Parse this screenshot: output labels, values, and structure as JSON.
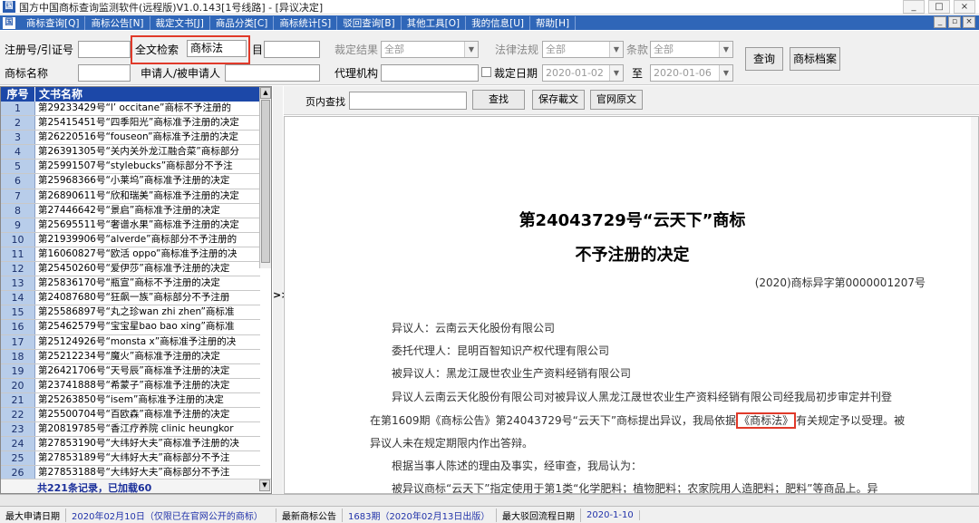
{
  "window": {
    "title": "国方中国商标查询监测软件(远程版)V1.0.143[1号线路] - [异议决定]",
    "controls": [
      "_",
      "□",
      "×"
    ]
  },
  "menu": {
    "items": [
      "商标查询[Q]",
      "商标公告[N]",
      "裁定文书[J]",
      "商品分类[C]",
      "商标统计[S]",
      "驳回查询[B]",
      "其他工具[O]",
      "我的信息[U]",
      "帮助[H]"
    ],
    "mdi_controls": [
      "_",
      "▫",
      "×"
    ]
  },
  "search": {
    "reg_no_label": "注册号/引证号",
    "reg_no_value": "",
    "fulltext_label": "全文检索",
    "fulltext_value": "商标法",
    "date_suffix_label": "目",
    "date_suffix_value": "",
    "ruling_result_label": "裁定结果",
    "ruling_result_value": "全部",
    "law_label": "法律法规",
    "law_value": "全部",
    "clause_label": "条款",
    "clause_value": "全部",
    "mark_name_label": "商标名称",
    "mark_name_value": "",
    "applicant_label": "申请人/被申请人",
    "applicant_value": "",
    "agency_label": "代理机构",
    "agency_value": "",
    "ruling_date_label": "裁定日期",
    "date_from": "2020-01-02",
    "to_label": "至",
    "date_to": "2020-01-06",
    "query_button": "查询",
    "archive_button": "商标档案"
  },
  "list": {
    "col_no": "序号",
    "col_name": "文书名称",
    "rows": [
      {
        "no": "1",
        "name": "第29233429号“l’ occitane”商标不予注册的"
      },
      {
        "no": "2",
        "name": "第25415451号“四季阳光”商标准予注册的决定"
      },
      {
        "no": "3",
        "name": "第26220516号“fouseon”商标准予注册的决定"
      },
      {
        "no": "4",
        "name": "第26391305号“关内关外龙江融合菜”商标部分"
      },
      {
        "no": "5",
        "name": "第25991507号“stylebucks”商标部分不予注"
      },
      {
        "no": "6",
        "name": "第25968366号“小莱坞”商标准予注册的决定"
      },
      {
        "no": "7",
        "name": "第26890611号“欣和瑞美”商标准予注册的决定"
      },
      {
        "no": "8",
        "name": "第27446642号“景启”商标准予注册的决定"
      },
      {
        "no": "9",
        "name": "第25695511号“奢谱水果”商标准予注册的决定"
      },
      {
        "no": "10",
        "name": "第21939906号“alverde”商标部分不予注册的"
      },
      {
        "no": "11",
        "name": "第16060827号“欧活 oppo”商标准予注册的决"
      },
      {
        "no": "12",
        "name": "第25450260号“爱伊莎”商标准予注册的决定"
      },
      {
        "no": "13",
        "name": "第25836170号“瓶宣”商标不予注册的决定"
      },
      {
        "no": "14",
        "name": "第24087680号“狂飙一族”商标部分不予注册"
      },
      {
        "no": "15",
        "name": "第25586897号“丸之珍wan zhi zhen”商标准"
      },
      {
        "no": "16",
        "name": "第25462579号“宝宝星bao bao xing”商标准"
      },
      {
        "no": "17",
        "name": "第25124926号“monsta x”商标准予注册的决"
      },
      {
        "no": "18",
        "name": "第25212234号“魔火”商标准予注册的决定"
      },
      {
        "no": "19",
        "name": "第26421706号“天号辰”商标准予注册的决定"
      },
      {
        "no": "20",
        "name": "第23741888号“希蒙子”商标准予注册的决定"
      },
      {
        "no": "21",
        "name": "第25263850号“isem”商标准予注册的决定"
      },
      {
        "no": "22",
        "name": "第25500704号“百欧森”商标准予注册的决定"
      },
      {
        "no": "23",
        "name": "第20819785号“香江疗养院 clinic heungkor"
      },
      {
        "no": "24",
        "name": "第27853190号“大纬好大夫”商标准予注册的决"
      },
      {
        "no": "25",
        "name": "第27853189号“大纬好大夫”商标部分不予注"
      },
      {
        "no": "26",
        "name": "第27853188号“大纬好大夫”商标部分不予注"
      }
    ],
    "total_text": "共221条记录，已加载60"
  },
  "splitter_label": ">>",
  "toolbar": {
    "page_find_label": "页内查找",
    "page_find_value": "",
    "find_button": "查找",
    "save_button": "保存載文",
    "official_button": "官网原文"
  },
  "document": {
    "title_line1": "第24043729号“云天下”商标",
    "title_line2": "不予注册的决定",
    "doc_number": "(2020)商标异字第0000001207号",
    "opposer": "异议人：云南云天化股份有限公司",
    "agent": "委托代理人：昆明百智知识产权代理有限公司",
    "opposed": "被异议人：黑龙江晟世农业生产资料经销有限公司",
    "p1a": "异议人云南云天化股份有限公司对被异议人黑龙江晟世农业生产资料经销有限公司经我局初步审定并刊登",
    "p1b_pre": "在第1609期《商标公告》第24043729号“云天下”商标提出异议，我局依据",
    "p1b_hl": "《商标法》",
    "p1b_post": "有关规定予以受理。被",
    "p1c": "异议人未在规定期限内作出答辩。",
    "p2": "根据当事人陈述的理由及事实，经审查，我局认为：",
    "p3": "被异议商标“云天下”指定使用于第1类“化学肥料；植物肥料；农家院用人造肥料；肥料”等商品上。异"
  },
  "status": {
    "latest_app_label": "最大申请日期",
    "latest_app_value": "2020年02月10日（仅限已在官网公开的商标）",
    "latest_notice_label": "最新商标公告",
    "latest_notice_value": "1683期（2020年02月13日出版）",
    "latest_reject_label": "最大驳回流程日期",
    "latest_reject_value": "2020-1-10"
  },
  "colors": {
    "menu_bg": "#2f66b8",
    "table_header": "#1c48a8",
    "row_number_bg": "#b8cdea",
    "highlight_red": "#e03a2a"
  }
}
